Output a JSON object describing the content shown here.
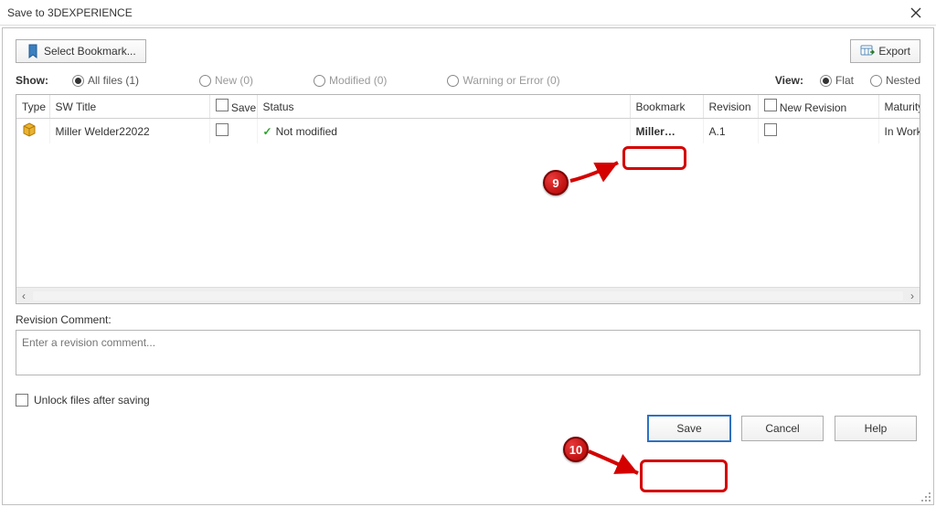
{
  "window": {
    "title": "Save to 3DEXPERIENCE"
  },
  "toolbar": {
    "select_bookmark": "Select Bookmark...",
    "export": "Export"
  },
  "show": {
    "label": "Show:",
    "all": "All files (1)",
    "new": "New (0)",
    "modified": "Modified (0)",
    "warning": "Warning or Error (0)"
  },
  "view": {
    "label": "View:",
    "flat": "Flat",
    "nested": "Nested"
  },
  "grid": {
    "headers": {
      "type": "Type",
      "sw_title": "SW Title",
      "save": "Save",
      "status": "Status",
      "bookmark": "Bookmark",
      "revision": "Revision",
      "new_revision": "New Revision",
      "maturity": "Maturity"
    },
    "rows": [
      {
        "sw_title": "Miller Welder22022",
        "status": "Not modified",
        "bookmark": "Miller…",
        "revision": "A.1",
        "maturity": "In Work"
      }
    ]
  },
  "revision_comment": {
    "label": "Revision Comment:",
    "placeholder": "Enter a revision comment..."
  },
  "unlock": {
    "label": "Unlock files after saving"
  },
  "footer": {
    "save": "Save",
    "cancel": "Cancel",
    "help": "Help"
  },
  "annotations": {
    "n9": "9",
    "n10": "10"
  }
}
